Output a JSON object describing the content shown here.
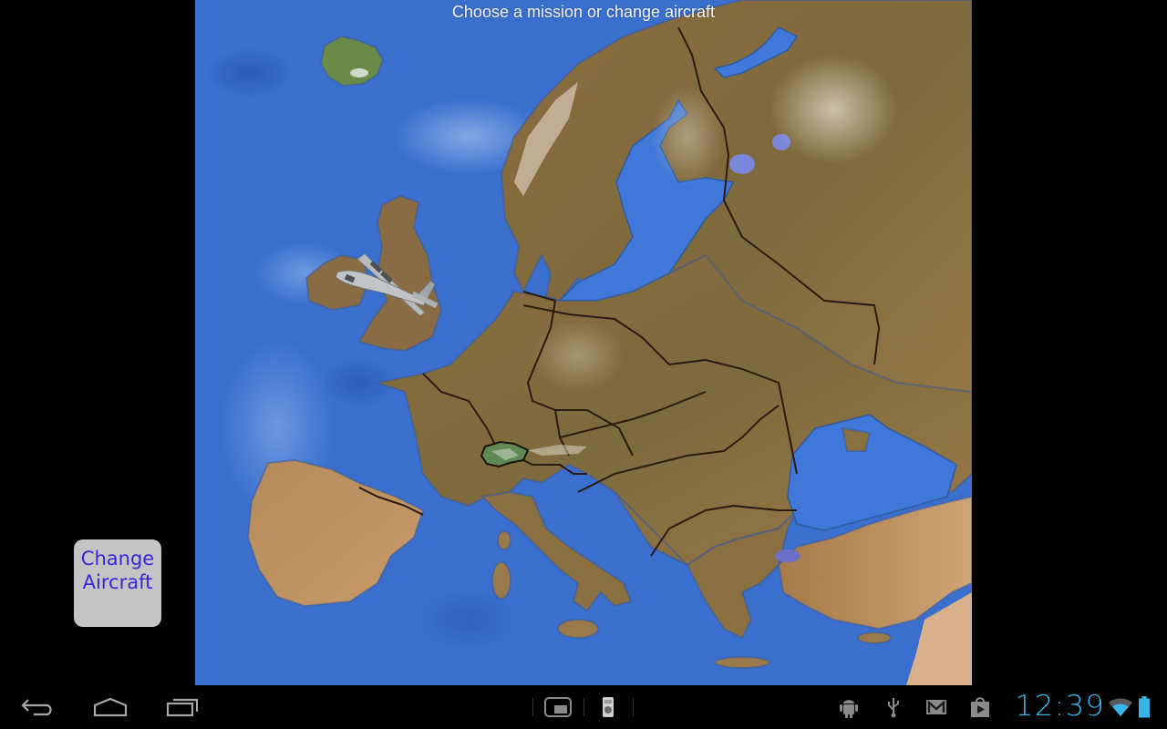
{
  "map": {
    "title": "Choose a mission or change aircraft",
    "highlighted_region": "Switzerland",
    "aircraft": "C-130 Hercules",
    "colors": {
      "sea": "#3a6fce",
      "land": "#8a6a3a",
      "highlight": "#5f8a55",
      "border": "#2a1a10"
    }
  },
  "buttons": {
    "change_aircraft": {
      "line1": "Change",
      "line2": "Aircraft",
      "text_color": "#3a25d8",
      "bg": "#c4c4c4"
    }
  },
  "navbar": {
    "back": "back-icon",
    "home": "home-icon",
    "recents": "recent-apps-icon",
    "notifications": [
      "screenshot-icon",
      "device-info-icon"
    ],
    "status_icons": [
      "android-debug-icon",
      "usb-icon",
      "gmail-icon",
      "play-store-icon"
    ],
    "time": "12:39",
    "wifi": "wifi-icon",
    "battery": "battery-icon",
    "accent": "#39b4e6"
  }
}
